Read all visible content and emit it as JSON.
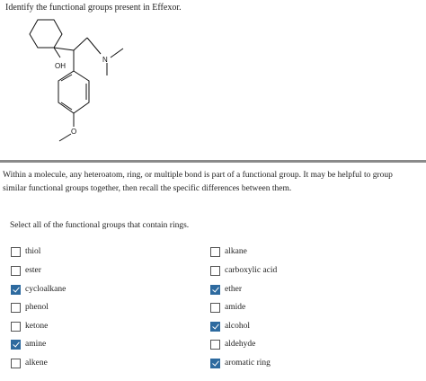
{
  "question": "Identify the functional groups present in Effexor.",
  "molecule": {
    "atom_oh": "OH",
    "atom_n": "N",
    "atom_o": "O"
  },
  "hint": "Within a molecule, any heteroatom, ring, or multiple bond is part of a functional group. It may be helpful to group similar functional groups together, then recall the specific differences between them.",
  "instruction": "Select all of the functional groups that contain rings.",
  "colors": {
    "checkbox_checked": "#2d6a9f",
    "divider": "#8a8a8a"
  },
  "options": {
    "left": [
      {
        "label": "thiol",
        "checked": false
      },
      {
        "label": "ester",
        "checked": false
      },
      {
        "label": "cycloalkane",
        "checked": true
      },
      {
        "label": "phenol",
        "checked": false
      },
      {
        "label": "ketone",
        "checked": false
      },
      {
        "label": "amine",
        "checked": true
      },
      {
        "label": "alkene",
        "checked": false
      }
    ],
    "right": [
      {
        "label": "alkane",
        "checked": false
      },
      {
        "label": "carboxylic acid",
        "checked": false
      },
      {
        "label": "ether",
        "checked": true
      },
      {
        "label": "amide",
        "checked": false
      },
      {
        "label": "alcohol",
        "checked": true
      },
      {
        "label": "aldehyde",
        "checked": false
      },
      {
        "label": "aromatic ring",
        "checked": true
      }
    ]
  }
}
